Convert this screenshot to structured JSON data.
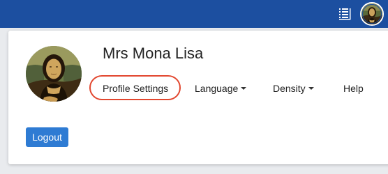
{
  "topbar": {
    "color": "#1c4fa0",
    "icons": [
      "list-icon",
      "user-avatar-icon"
    ]
  },
  "profile": {
    "name": "Mrs Mona Lisa"
  },
  "nav": {
    "items": [
      {
        "label": "Profile Settings",
        "dropdown": false,
        "highlighted": true
      },
      {
        "label": "Language",
        "dropdown": true
      },
      {
        "label": "Density",
        "dropdown": true
      },
      {
        "label": "Help",
        "dropdown": false
      }
    ]
  },
  "actions": {
    "logout_label": "Logout"
  },
  "colors": {
    "accent": "#2e7bd3",
    "highlight_ring": "#e2472f"
  }
}
